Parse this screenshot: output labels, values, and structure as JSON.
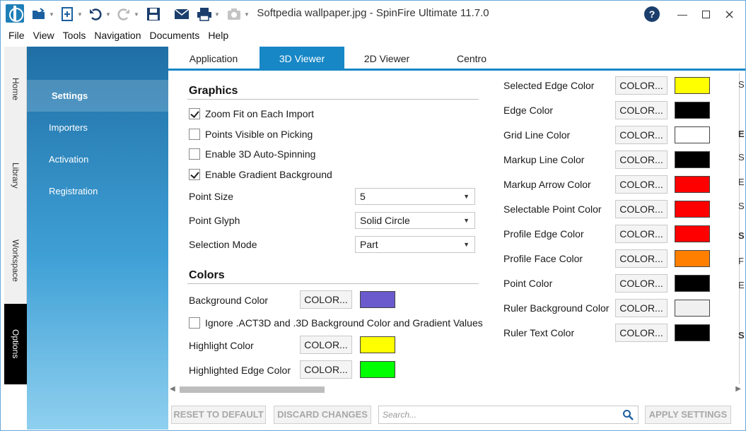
{
  "window": {
    "title": "Softpedia wallpaper.jpg - SpinFire Ultimate 11.7.0",
    "help_label": "?"
  },
  "icons": {
    "app_logo": "spinfire-logo-icon",
    "quick_access": [
      "open-folder-icon",
      "new-document-icon",
      "undo-icon",
      "redo-icon",
      "save-icon",
      "email-icon",
      "print-icon",
      "screenshot-icon"
    ],
    "window_controls": [
      "minimize-icon",
      "maximize-icon",
      "close-icon"
    ]
  },
  "menu": {
    "items": [
      "File",
      "View",
      "Tools",
      "Navigation",
      "Documents",
      "Help"
    ]
  },
  "side_tabs": [
    "Home",
    "Library",
    "Workspace",
    "Options"
  ],
  "nav": {
    "items": [
      "Settings",
      "Importers",
      "Activation",
      "Registration"
    ],
    "active": "Settings"
  },
  "tabs": {
    "items": [
      "Application",
      "3D Viewer",
      "2D Viewer",
      "Centro"
    ],
    "active": "3D Viewer"
  },
  "graphics": {
    "title": "Graphics",
    "checkboxes": [
      {
        "label": "Zoom Fit on Each Import",
        "checked": true
      },
      {
        "label": "Points Visible on Picking",
        "checked": false
      },
      {
        "label": "Enable 3D Auto-Spinning",
        "checked": false
      },
      {
        "label": "Enable Gradient Background",
        "checked": true
      }
    ],
    "point_size": {
      "label": "Point Size",
      "value": "5"
    },
    "point_glyph": {
      "label": "Point Glyph",
      "value": "Solid Circle"
    },
    "selection_mode": {
      "label": "Selection Mode",
      "value": "Part"
    }
  },
  "colors": {
    "title": "Colors",
    "button_label": "COLOR...",
    "background": {
      "label": "Background Color",
      "color": "#6a5acd"
    },
    "ignore_checkbox": {
      "label": "Ignore .ACT3D and .3D Background Color and Gradient Values",
      "checked": false
    },
    "highlight": {
      "label": "Highlight Color",
      "color": "#ffff00"
    },
    "highlighted_edge": {
      "label": "Highlighted Edge Color",
      "color": "#00ff00"
    }
  },
  "right_colors": [
    {
      "label": "Selected Edge Color",
      "color": "#ffff00"
    },
    {
      "label": "Edge Color",
      "color": "#000000"
    },
    {
      "label": "Grid Line Color",
      "color": "#ffffff"
    },
    {
      "label": "Markup Line Color",
      "color": "#000000"
    },
    {
      "label": "Markup Arrow Color",
      "color": "#ff0000"
    },
    {
      "label": "Selectable Point Color",
      "color": "#ff0000"
    },
    {
      "label": "Profile Edge Color",
      "color": "#ff0000"
    },
    {
      "label": "Profile Face Color",
      "color": "#ff8000"
    },
    {
      "label": "Point Color",
      "color": "#000000"
    },
    {
      "label": "Ruler Background Color",
      "color": "#f0f0f0"
    },
    {
      "label": "Ruler Text Color",
      "color": "#000000"
    }
  ],
  "partial_column": [
    "S",
    "E",
    "S",
    "E",
    "S",
    "S",
    "F",
    "E",
    "S"
  ],
  "bottom": {
    "reset_label": "RESET TO DEFAULT",
    "discard_label": "DISCARD CHANGES",
    "search_placeholder": "Search...",
    "apply_label": "APPLY SETTINGS"
  },
  "theme": {
    "accent": "#1787c6"
  }
}
